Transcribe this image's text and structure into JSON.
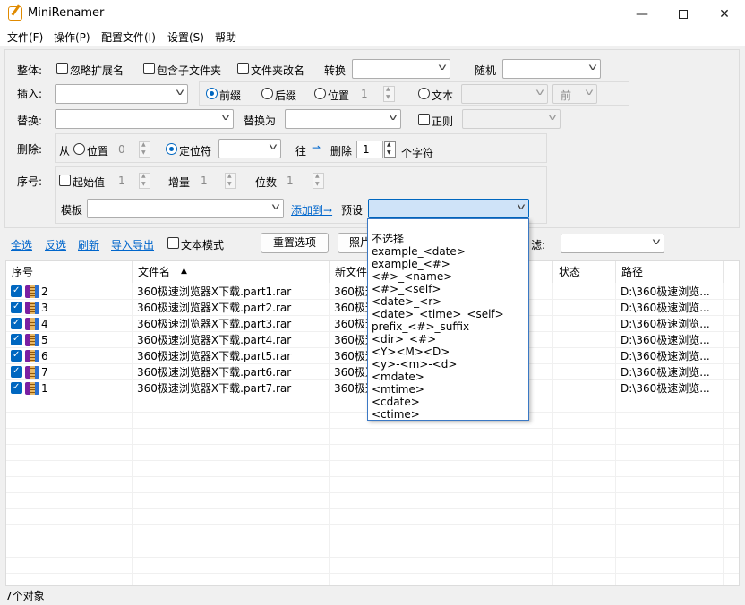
{
  "window": {
    "title": "MiniRenamer"
  },
  "menu": [
    "文件(F)",
    "操作(P)",
    "配置文件(I)",
    "设置(S)",
    "帮助"
  ],
  "overall": {
    "label": "整体:",
    "ignore_ext": "忽略扩展名",
    "include_sub": "包含子文件夹",
    "rename_folder": "文件夹改名",
    "convert": "转换",
    "random": "随机"
  },
  "insert": {
    "label": "插入:",
    "prefix": "前缀",
    "suffix": "后缀",
    "position": "位置",
    "position_value": "1",
    "text": "文本",
    "front": "前"
  },
  "replace": {
    "label": "替换:",
    "replace_with": "替换为",
    "regex": "正则"
  },
  "delete": {
    "label": "删除:",
    "from": "从",
    "position": "位置",
    "position_value": "0",
    "locator": "定位符",
    "direction": "往",
    "arrow": "⇀",
    "delete": "删除",
    "count": "1",
    "unit": "个字符"
  },
  "sequence": {
    "label": "序号:",
    "start": "起始值",
    "start_value": "1",
    "step": "增量",
    "step_value": "1",
    "digits": "位数",
    "digits_value": "1",
    "template": "模板",
    "add_to": "添加到→",
    "preset": "预设"
  },
  "toolbar": {
    "select_all": "全选",
    "invert": "反选",
    "refresh": "刷新",
    "import_export": "导入导出",
    "text_mode": "文本模式",
    "reset": "重置选项",
    "photo_btn": "照片",
    "filter": "滤:"
  },
  "table": {
    "headers": {
      "seq": "序号",
      "name": "文件名",
      "newname": "新文件",
      "status": "状态",
      "path": "路径"
    },
    "rows": [
      {
        "seq": "2",
        "name": "360极速浏览器X下载.part1.rar",
        "newname": "360极速",
        "path": "D:\\360极速浏览..."
      },
      {
        "seq": "3",
        "name": "360极速浏览器X下载.part2.rar",
        "newname": "360极速",
        "path": "D:\\360极速浏览..."
      },
      {
        "seq": "4",
        "name": "360极速浏览器X下载.part3.rar",
        "newname": "360极速",
        "path": "D:\\360极速浏览..."
      },
      {
        "seq": "5",
        "name": "360极速浏览器X下载.part4.rar",
        "newname": "360极速",
        "path": "D:\\360极速浏览..."
      },
      {
        "seq": "6",
        "name": "360极速浏览器X下载.part5.rar",
        "newname": "360极速",
        "path": "D:\\360极速浏览..."
      },
      {
        "seq": "7",
        "name": "360极速浏览器X下载.part6.rar",
        "newname": "360极速",
        "path": "D:\\360极速浏览..."
      },
      {
        "seq": "1",
        "name": "360极速浏览器X下载.part7.rar",
        "newname": "360极速",
        "path": "D:\\360极速浏览..."
      }
    ]
  },
  "preset_options": [
    "不选择",
    "example_<date>",
    "example_<#>",
    "<#>_<name>",
    "<#>_<self>",
    "<date>_<r>",
    "<date>_<time>_<self>",
    "prefix_<#>_suffix",
    "<dir>_<#>",
    "<Y><M><D>",
    "<y>-<m>-<d>",
    "<mdate>",
    "<mtime>",
    "<cdate>",
    "<ctime>"
  ],
  "status": {
    "count": "7个对象"
  },
  "colors": {
    "accent": "#0067c0",
    "link": "#0066cc"
  }
}
